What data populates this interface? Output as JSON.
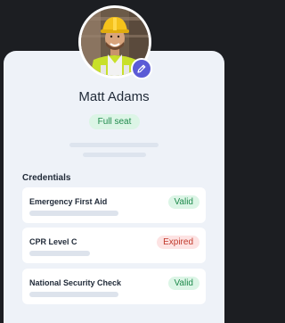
{
  "profile": {
    "name": "Matt Adams",
    "seat_label": "Full seat"
  },
  "credentials": {
    "heading": "Credentials",
    "items": [
      {
        "title": "Emergency First Aid",
        "status": "Valid",
        "status_type": "valid"
      },
      {
        "title": "CPR Level C",
        "status": "Expired",
        "status_type": "expired"
      },
      {
        "title": "National Security Check",
        "status": "Valid",
        "status_type": "valid"
      }
    ]
  },
  "colors": {
    "background": "#1c1e22",
    "card": "#eef2f8",
    "accent": "#5b5bd6",
    "valid_text": "#1f8a4c",
    "valid_bg": "#dcf5e6",
    "expired_text": "#c0392b",
    "expired_bg": "#fde3e3"
  },
  "icons": {
    "edit": "pencil-icon"
  }
}
